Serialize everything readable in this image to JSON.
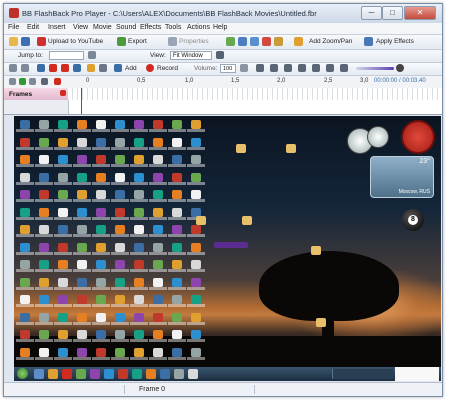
{
  "window": {
    "title": "BB FlashBack Pro Player - C:\\Users\\ALEX\\Documents\\BB FlashBack Movies\\Untitled.fbr",
    "minimize": "─",
    "maximize": "□",
    "close": "✕"
  },
  "menu": [
    "File",
    "Edit",
    "Insert",
    "View",
    "Movie",
    "Sound",
    "Effects",
    "Tools",
    "Actions",
    "Help"
  ],
  "toolbar1": {
    "upload": "Upload to YouTube",
    "export": "Export",
    "properties": "Properties",
    "add_zoom": "Add Zoom/Pan",
    "apply_effects": "Apply Effects"
  },
  "toolbar2": {
    "jump_to": "Jump to:",
    "view_label": "View:",
    "view_value": "Fit Window"
  },
  "toolbar3": {
    "add": "Add",
    "record": "Record",
    "volume_label": "Volume:",
    "volume_value": "100"
  },
  "timeline": {
    "ticks": [
      "0",
      "0,5",
      "1,0",
      "1,5",
      "2,0",
      "2,5",
      "3,0"
    ],
    "time": "00:00:00 / 00:03.40"
  },
  "frames_label": "Frames",
  "desktop": {
    "weather_temp": "23°",
    "weather_location": "Moscow, RUS",
    "ball_number": "8"
  },
  "status": {
    "frame": "Frame 0"
  },
  "colors": {
    "accent": "#3a6ea5",
    "record": "#d22a1e",
    "play": "#2f9a2f"
  }
}
